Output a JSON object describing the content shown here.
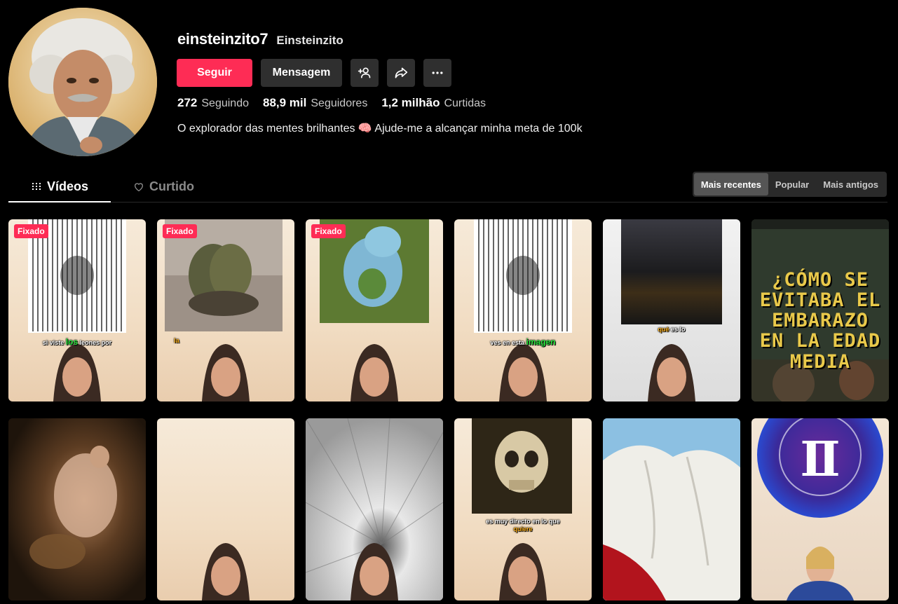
{
  "profile": {
    "username": "einsteinzito7",
    "nickname": "Einsteinzito",
    "bio": "O explorador das mentes brilhantes 🧠 Ajude-me a alcançar minha meta de 100k"
  },
  "actions": {
    "follow_label": "Seguir",
    "message_label": "Mensagem",
    "icons": [
      "add-friend-icon",
      "share-icon",
      "more-icon"
    ]
  },
  "stats": {
    "following_count": "272",
    "following_label": "Seguindo",
    "followers_count": "88,9 mil",
    "followers_label": "Seguidores",
    "likes_count": "1,2 milhão",
    "likes_label": "Curtidas"
  },
  "tabs": {
    "videos": "Vídeos",
    "liked": "Curtido"
  },
  "sort": {
    "options": [
      "Mais recentes",
      "Popular",
      "Mais antigos"
    ],
    "active": "Mais recentes"
  },
  "colors": {
    "accent": "#fe2c55",
    "background": "#000000",
    "button_dark": "#2f2f2f"
  },
  "videos": [
    {
      "badge": "Fixado",
      "caption_pre": "si viste ",
      "caption_hl": "los",
      "caption_post": " leones por"
    },
    {
      "badge": "Fixado",
      "caption": "la"
    },
    {
      "badge": "Fixado"
    },
    {
      "caption_pre": "ves en esta ",
      "caption_hl": "imagen"
    },
    {
      "caption_pre": "qué",
      "caption_post": " es lo"
    },
    {
      "poster_text": "¿CÓMO SE EVITABA EL EMBARAZO EN LA EDAD MEDIA"
    },
    {},
    {},
    {},
    {
      "caption_pre": "es muy directo en lo que",
      "caption_hl": "quiere"
    },
    {},
    {}
  ]
}
